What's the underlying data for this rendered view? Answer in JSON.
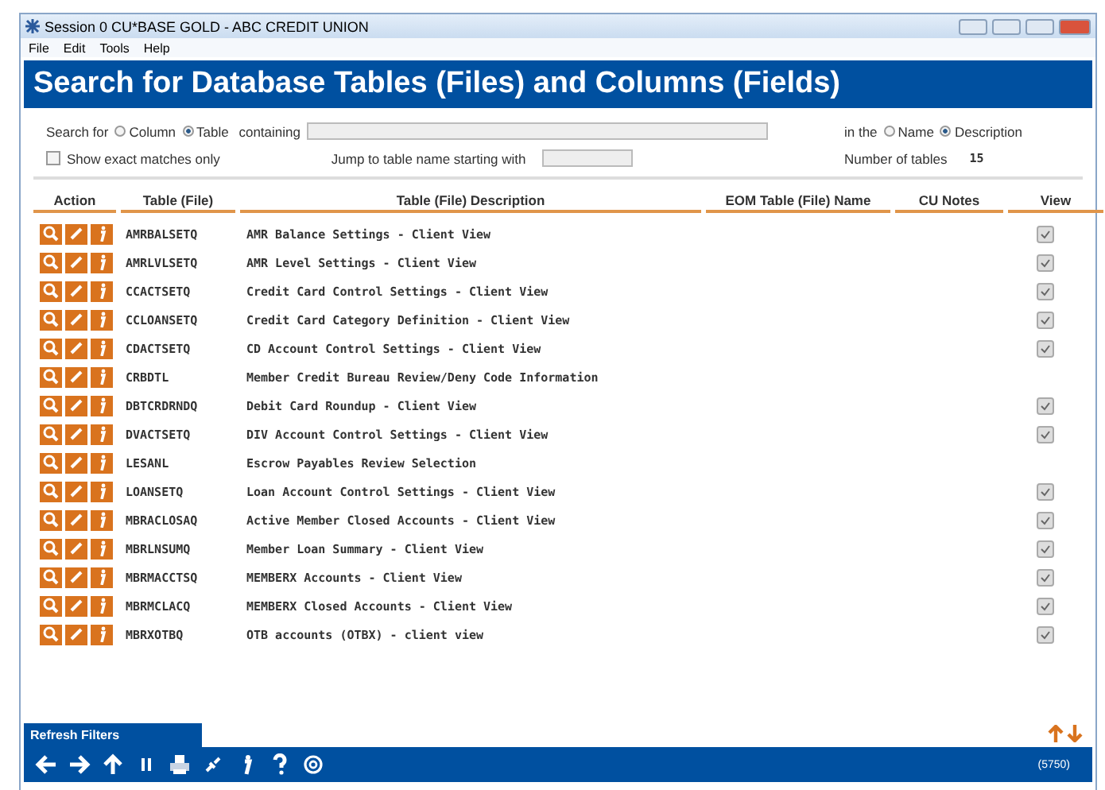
{
  "window": {
    "title": "Session 0 CU*BASE GOLD - ABC CREDIT UNION"
  },
  "menu": [
    "File",
    "Edit",
    "Tools",
    "Help"
  ],
  "header": {
    "title": "Search for Database Tables (Files) and Columns (Fields)"
  },
  "search": {
    "label": "Search for",
    "targets": [
      {
        "label": "Column",
        "selected": false
      },
      {
        "label": "Table",
        "selected": true
      }
    ],
    "containing_label": "containing",
    "in_label": "in the",
    "fields": [
      {
        "label": "Name",
        "selected": false
      },
      {
        "label": "Description",
        "selected": true
      }
    ],
    "exact_label": "Show exact matches only",
    "exact_checked": false,
    "jump_label": "Jump to table name starting with",
    "count_label": "Number of tables",
    "count": "15"
  },
  "table": {
    "columns": [
      "Action",
      "Table (File)",
      "Table (File) Description",
      "EOM Table (File) Name",
      "CU Notes",
      "View"
    ],
    "rows": [
      {
        "file": "AMRBALSETQ",
        "description": "AMR Balance Settings - Client View",
        "view": true
      },
      {
        "file": "AMRLVLSETQ",
        "description": "AMR Level Settings - Client View",
        "view": true
      },
      {
        "file": "CCACTSETQ",
        "description": "Credit Card Control Settings - Client View",
        "view": true
      },
      {
        "file": "CCLOANSETQ",
        "description": "Credit Card Category Definition - Client View",
        "view": true
      },
      {
        "file": "CDACTSETQ",
        "description": "CD Account Control Settings - Client View",
        "view": true
      },
      {
        "file": "CRBDTL",
        "description": "Member Credit Bureau Review/Deny Code Information",
        "view": false
      },
      {
        "file": "DBTCRDRNDQ",
        "description": "Debit Card Roundup - Client View",
        "view": true
      },
      {
        "file": "DVACTSETQ",
        "description": "DIV Account Control Settings - Client View",
        "view": true
      },
      {
        "file": "LESANL",
        "description": "Escrow Payables Review Selection",
        "view": false
      },
      {
        "file": "LOANSETQ",
        "description": "Loan Account Control Settings - Client View",
        "view": true
      },
      {
        "file": "MBRACLOSAQ",
        "description": "Active Member Closed Accounts - Client View",
        "view": true
      },
      {
        "file": "MBRLNSUMQ",
        "description": "Member Loan Summary - Client View",
        "view": true
      },
      {
        "file": "MBRMACCTSQ",
        "description": "MEMBERX Accounts - Client View",
        "view": true
      },
      {
        "file": "MBRMCLACQ",
        "description": "MEMBERX Closed Accounts - Client View",
        "view": true
      },
      {
        "file": "MBRXOTBQ",
        "description": "OTB accounts (OTBX) - client view",
        "view": true
      }
    ]
  },
  "refresh_button": "Refresh Filters",
  "toolbar": {
    "screen_id": "(5750)"
  }
}
